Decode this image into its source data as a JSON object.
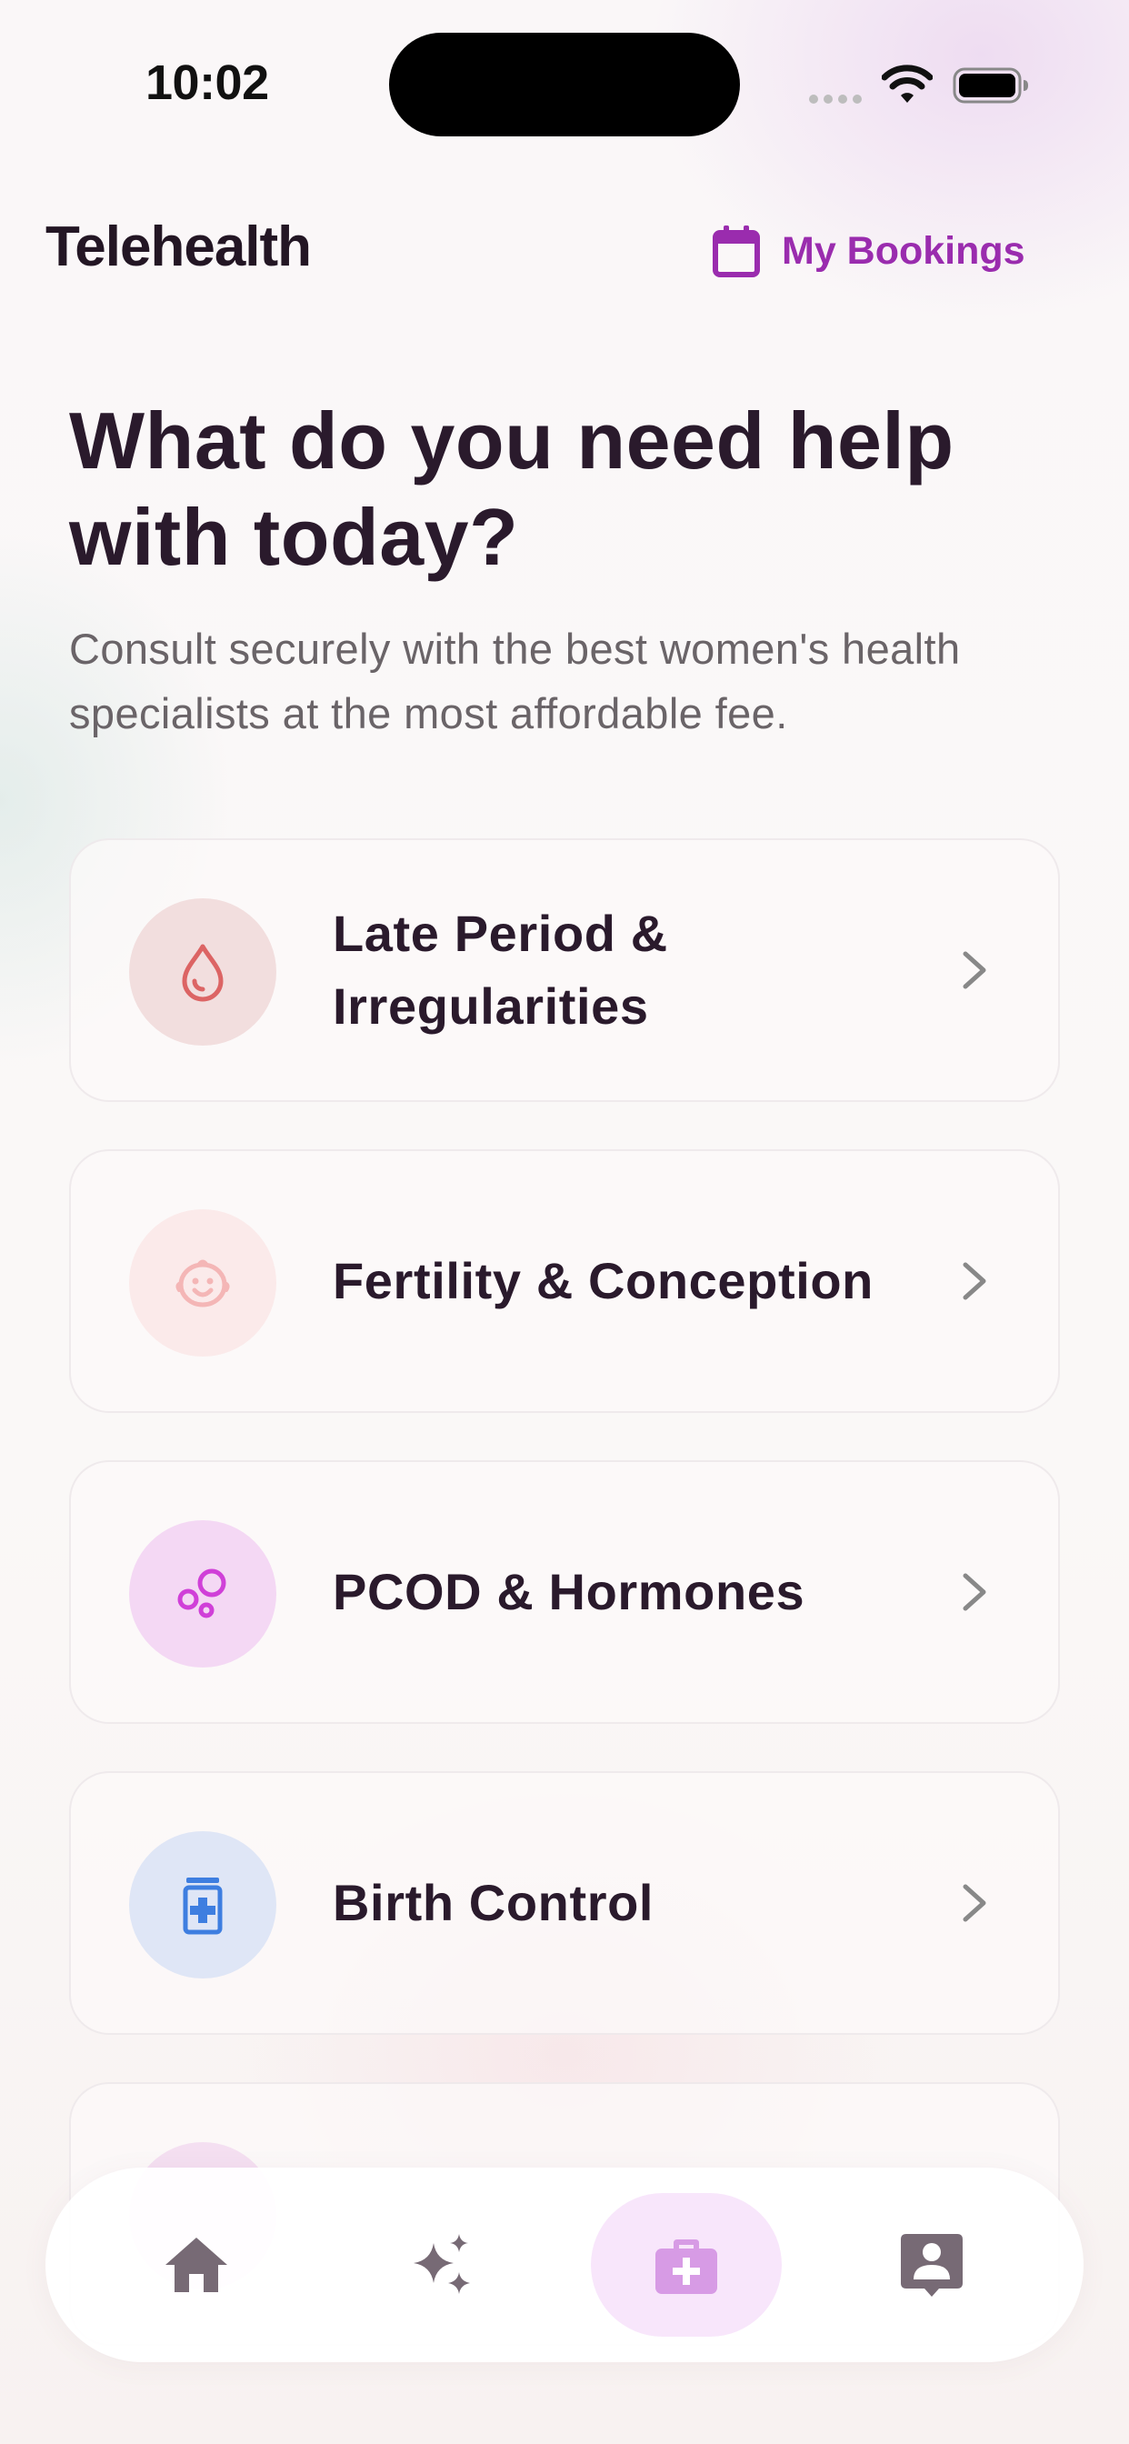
{
  "status_bar": {
    "time": "10:02"
  },
  "header": {
    "title": "Telehealth",
    "bookings_label": "My Bookings",
    "accent_color": "#9a2cae"
  },
  "hero": {
    "title": "What do you need help with today?",
    "subtitle": "Consult securely with the best women's health specialists at the most affordable fee."
  },
  "categories": [
    {
      "label": "Late Period & Irregularities",
      "icon": "drop-icon",
      "icon_bg": "#f2dede",
      "icon_color": "#dc6464"
    },
    {
      "label": "Fertility & Conception",
      "icon": "baby-face-icon",
      "icon_bg": "#fbeaea",
      "icon_color": "#f6bcbc"
    },
    {
      "label": "PCOD & Hormones",
      "icon": "bubbles-icon",
      "icon_bg": "#f4d8f4",
      "icon_color": "#d040d8"
    },
    {
      "label": "Birth Control",
      "icon": "medicine-bottle-icon",
      "icon_bg": "#dfe6f6",
      "icon_color": "#3e7ee0"
    },
    {
      "label": "",
      "icon": "",
      "icon_bg": "#f4dff1",
      "icon_color": ""
    }
  ],
  "bottom_nav": {
    "items": [
      {
        "icon": "home-icon",
        "active": false
      },
      {
        "icon": "sparkles-icon",
        "active": false
      },
      {
        "icon": "medical-kit-icon",
        "active": true
      },
      {
        "icon": "profile-icon",
        "active": false
      }
    ],
    "active_color": "#d79be5",
    "inactive_color": "#776a75"
  }
}
